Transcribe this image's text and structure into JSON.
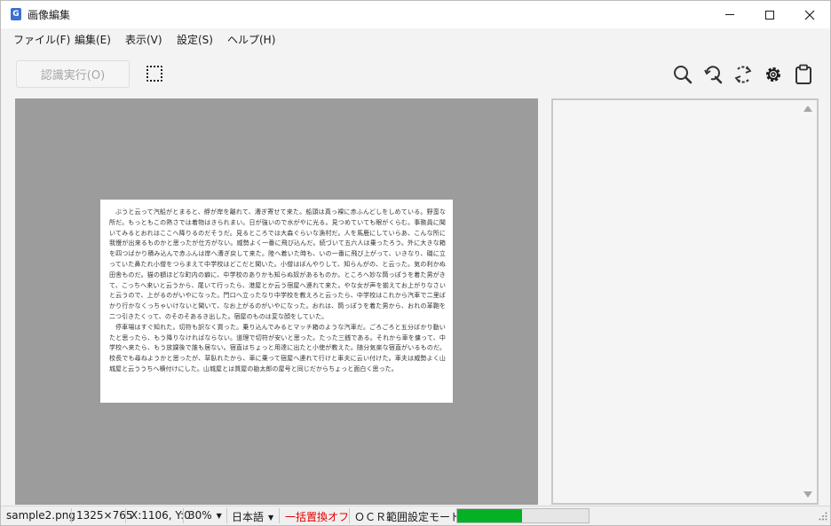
{
  "window": {
    "title": "画像編集",
    "app_icon_letter": "G"
  },
  "menu": [
    {
      "label": "ファイル(F)"
    },
    {
      "label": "編集(E)"
    },
    {
      "label": "表示(V)"
    },
    {
      "label": "設定(S)"
    },
    {
      "label": "ヘルプ(H)"
    }
  ],
  "toolbar": {
    "recognize_label": "認識実行(O)",
    "icons": [
      "zoom-in-icon",
      "zoom-out-icon",
      "rotate-icon",
      "settings-icon",
      "clipboard-icon"
    ]
  },
  "document": {
    "paragraphs": [
      "ぶうと云って汽船がとまると、艀が岸を離れて、漕ぎ寄せて来た。船頭は真っ裸に赤ふんどしをしめている。野蛮な所だ。もっともこの熱さでは着物はきられまい。日が強いので水がやに光る。見つめていても眼がくらむ。事務員に聞いてみるとおれはここへ降りるのだそうだ。見るところでは大森ぐらいな漁村だ。人を馬鹿にしていらあ、こんな所に我慢が出来るものかと思ったが仕方がない。威勢よく一番に飛び込んだ。続づいて五六人は乗ったろう。外に大きな箱を四つばかり積み込んで赤ふんは岸へ漕ぎ戻して来た。陸へ着いた時も、いの一番に飛び上がって、いきなり、磯に立っていた鼻たれ小僧をつらまえて中学校はどこだと聞いた。小僧はぼんやりして、知らんがの、と云った。気の利かぬ田舎ものだ。猫の額ほどな町内の癖に、中学校のありかも知らぬ奴があるものか。ところへ妙な筒っぽうを着た男がきて、こっちへ来いと云うから、尾いて行ったら、港屋とか云う宿屋へ連れて来た。やな女が声を揃えてお上がりなさいと云うので、上がるのがいやになった。門口へ立ったなり中学校を教えろと云ったら、中学校はこれから汽車で二里ばかり行かなくっちゃいけないと聞いて、なお上がるのがいやになった。おれは、筒っぽうを着た男から、おれの革鞄を二つ引きたくって、のそのそあるき出した。宿屋のものは変な顔をしていた。",
      "停車場はすぐ知れた。切符も訳なく買った。乗り込んでみるとマッチ箱のような汽車だ。ごろごろと五分ばかり動いたと思ったら、もう降りなければならない。道理で切符が安いと思った。たった三銭である。それから車を傭って、中学校へ来たら、もう放課後で誰も居ない。宿直はちょっと用達に出たと小使が教えた。随分気楽な宿直がいるものだ。校長でも尋ねようかと思ったが、草臥れたから、車に乗って宿屋へ連れて行けと車夫に云い付けた。車夫は威勢よく山城屋と云ううちへ横付けにした。山城屋とは質屋の勘太郎の屋号と同じだからちょっと面白く思った。"
    ]
  },
  "status": {
    "filename": "sample2.png",
    "dimensions": "1325×765",
    "coords": "X:1106, Y:0",
    "zoom": "30%",
    "language": "日本語",
    "replace": "一括置換オフ",
    "mode": "ＯＣＲ範囲設定モード",
    "progress_fraction": 0.49,
    "colors": {
      "replace": "#e00000",
      "progress": "#06b025"
    }
  }
}
